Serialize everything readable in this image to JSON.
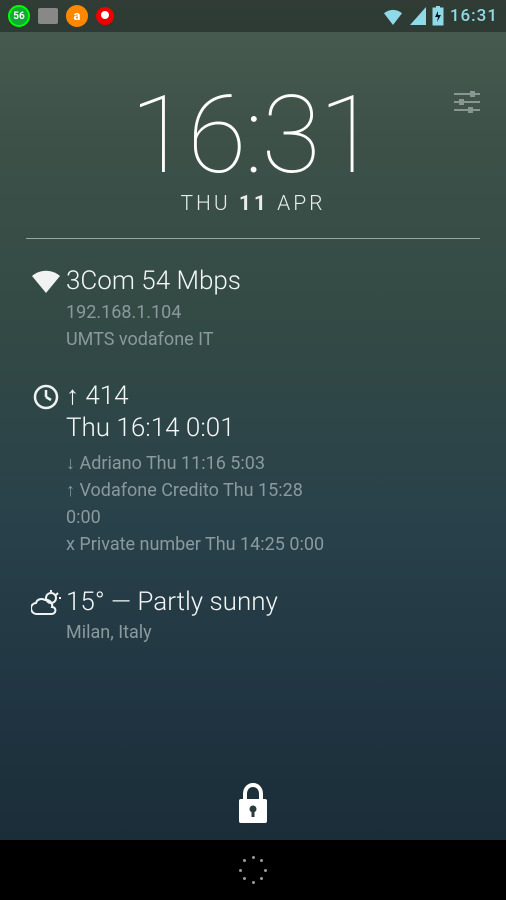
{
  "statusbar": {
    "badge": "56",
    "time": "16:31"
  },
  "clock": {
    "time": "16:31",
    "date_day": "THU",
    "date_num": "11",
    "date_month": "APR"
  },
  "wifi": {
    "title": "3Com 54 Mbps",
    "ip": "192.168.1.104",
    "carrier": "UMTS vodafone IT"
  },
  "calls": {
    "line1": "↑ 414",
    "line2": "Thu 16:14  0:01",
    "log1": "↓ Adriano Thu 11:16  5:03",
    "log2": "↑ Vodafone Credito Thu 15:28",
    "log3": "0:00",
    "log4": "x Private number Thu 14:25  0:00"
  },
  "weather": {
    "summary": "15° — Partly sunny",
    "location": "Milan, Italy"
  }
}
